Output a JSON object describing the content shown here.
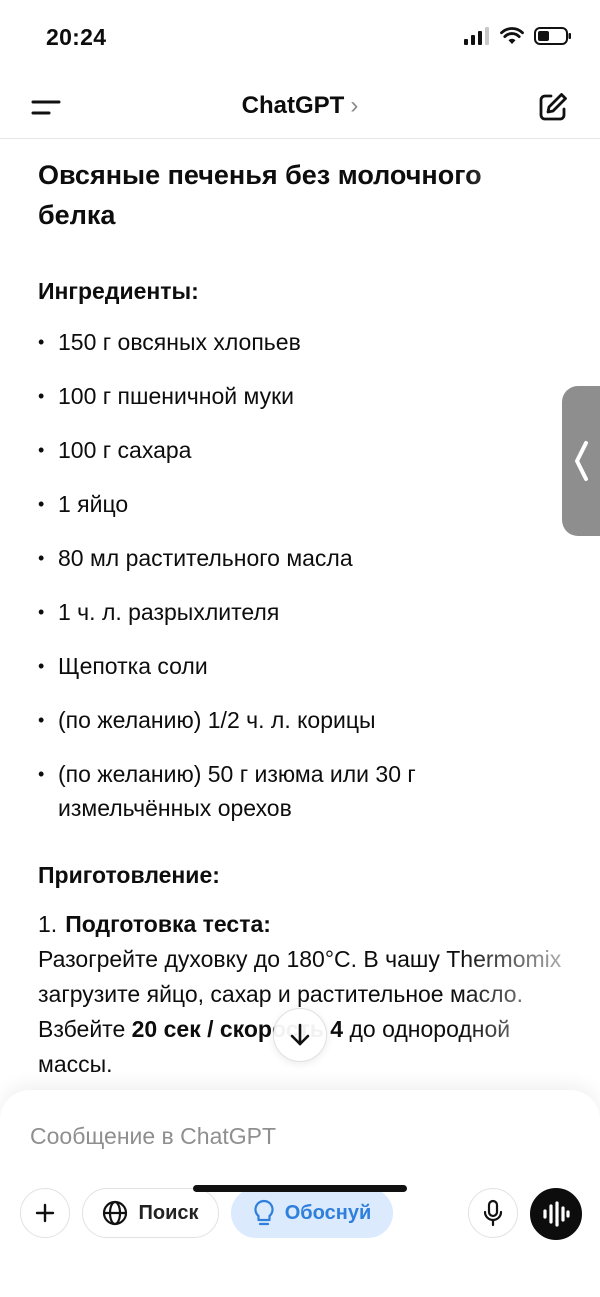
{
  "status_bar": {
    "time": "20:24"
  },
  "nav": {
    "title": "ChatGPT",
    "chevron": "›"
  },
  "content": {
    "title": "Овсяные печенья без молочного белка",
    "ingredients_heading": "Ингредиенты:",
    "ingredients": [
      "150 г овсяных хлопьев",
      "100 г пшеничной муки",
      "100 г сахара",
      "1 яйцо",
      "80 мл растительного масла",
      "1 ч. л. разрыхлителя",
      "Щепотка соли",
      "(по желанию) 1/2 ч. л. корицы",
      "(по желанию) 50 г изюма или 30 г измельчённых орехов"
    ],
    "preparation_heading": "Приготовление:",
    "step1": {
      "number": "1.",
      "title": "Подготовка теста:",
      "text_a": "Разогрейте духовку до 180°C. В чашу Thermomix загрузите яйцо, сахар и растительное масло. Взбейте ",
      "bold": "20 сек / скорость 4",
      "text_b": " до однородной массы."
    }
  },
  "composer": {
    "placeholder": "Сообщение в ChatGPT",
    "search_label": "Поиск",
    "reason_label": "Обоснуй"
  },
  "colors": {
    "accent_blue": "#2f7fdc",
    "accent_blue_bg": "#dbeafd",
    "handle_gray": "#8e8e8e"
  },
  "icons": {
    "menu": "menu-icon",
    "new_chat": "new-chat-icon",
    "side_handle": "chevron-left-icon",
    "scroll_down": "arrow-down-icon",
    "plus": "plus-icon",
    "search": "globe-icon",
    "reason": "lightbulb-icon",
    "mic": "mic-icon",
    "voice": "voice-waveform-icon"
  }
}
